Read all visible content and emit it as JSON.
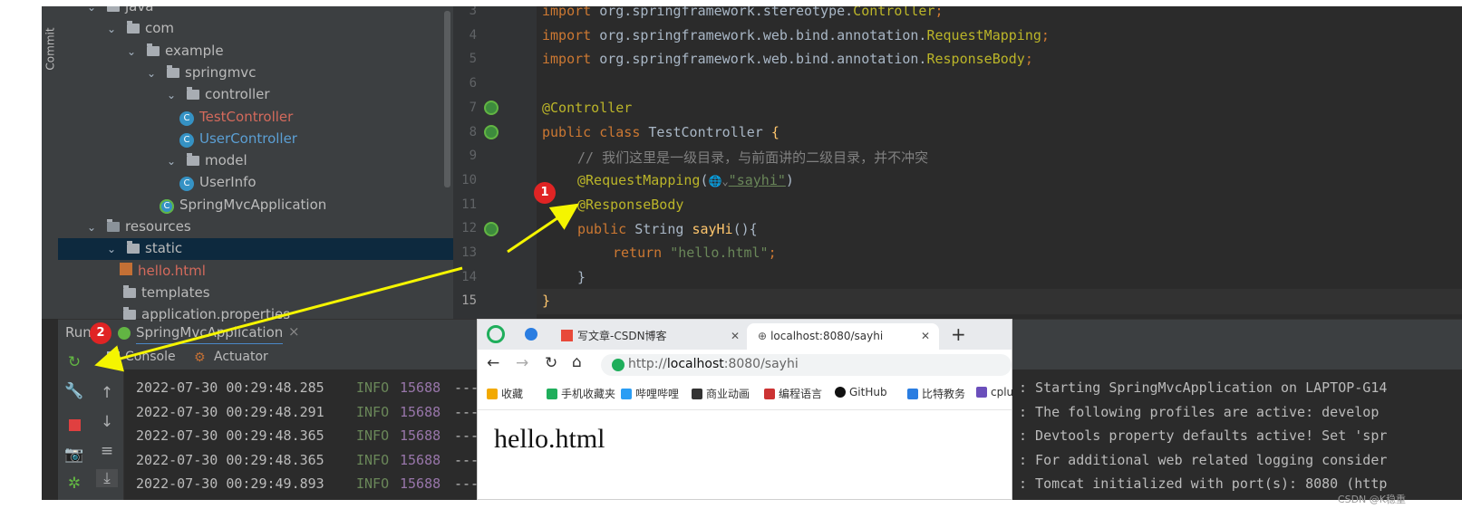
{
  "ide": {
    "commit_label": "Commit",
    "project_tree": [
      {
        "label": "java",
        "indent": 0,
        "type": "folder-partial"
      },
      {
        "label": "com",
        "indent": 1,
        "type": "package"
      },
      {
        "label": "example",
        "indent": 2,
        "type": "package"
      },
      {
        "label": "springmvc",
        "indent": 3,
        "type": "package"
      },
      {
        "label": "controller",
        "indent": 4,
        "type": "package"
      },
      {
        "label": "TestController",
        "indent": 5,
        "type": "class-modified"
      },
      {
        "label": "UserController",
        "indent": 5,
        "type": "class-new"
      },
      {
        "label": "model",
        "indent": 4,
        "type": "package"
      },
      {
        "label": "UserInfo",
        "indent": 5,
        "type": "class"
      },
      {
        "label": "SpringMvcApplication",
        "indent": 4,
        "type": "boot-class"
      },
      {
        "label": "resources",
        "indent": 0,
        "type": "resources"
      },
      {
        "label": "static",
        "indent": 1,
        "type": "folder-selected"
      },
      {
        "label": "hello.html",
        "indent": 2,
        "type": "html-modified"
      },
      {
        "label": "templates",
        "indent": 1,
        "type": "folder"
      },
      {
        "label": "application.properties",
        "indent": 1,
        "type": "partial"
      }
    ],
    "line_numbers": [
      "3",
      "4",
      "5",
      "6",
      "7",
      "8",
      "9",
      "10",
      "11",
      "12",
      "13",
      "14",
      "15"
    ],
    "code": {
      "l3_kw": "import",
      "l3_pkg": " org.springframework.stereotype.",
      "l3_cls": "Controller",
      "l3_end": ";",
      "l4_kw": "import",
      "l4_pkg": " org.springframework.web.bind.annotation.",
      "l4_cls": "RequestMapping",
      "l4_end": ";",
      "l5_kw": "import",
      "l5_pkg": " org.springframework.web.bind.annotation.",
      "l5_cls": "ResponseBody",
      "l5_end": ";",
      "l7_ann": "@Controller",
      "l8_kw": "public class",
      "l8_name": " TestController ",
      "l8_brace": "{",
      "l9_comment": "// 我们这里是一级目录，与前面讲的二级目录，并不冲突",
      "l10_ann": "@RequestMapping",
      "l10_open": "(",
      "l10_icon": "🌐⌄",
      "l10_str": "\"sayhi\"",
      "l10_close": ")",
      "l11_ann": "@ResponseBody",
      "l12_kw": "public",
      "l12_type": " String ",
      "l12_fn": "sayHi",
      "l12_rest": "(){",
      "l13_kw": "return",
      "l13_str": " \"hello.html\"",
      "l13_end": ";",
      "l14": "}",
      "l15": "}"
    },
    "run": {
      "label": "Run:",
      "config": "SpringMvcApplication",
      "tab_console": "Console",
      "tab_actuator": "Actuator"
    },
    "logs": [
      {
        "time": "2022-07-30 00:29:48.285",
        "level": "INFO",
        "pid": "15688",
        "sep": "---",
        "msg": ": Starting SpringMvcApplication on LAPTOP-G14"
      },
      {
        "time": "2022-07-30 00:29:48.291",
        "level": "INFO",
        "pid": "15688",
        "sep": "---",
        "msg": ": The following profiles are active: develop"
      },
      {
        "time": "2022-07-30 00:29:48.365",
        "level": "INFO",
        "pid": "15688",
        "sep": "---",
        "msg": ": Devtools property defaults active! Set 'spr"
      },
      {
        "time": "2022-07-30 00:29:48.365",
        "level": "INFO",
        "pid": "15688",
        "sep": "---",
        "msg": ": For additional web related logging consider"
      },
      {
        "time": "2022-07-30 00:29:49.893",
        "level": "INFO",
        "pid": "15688",
        "sep": "---",
        "msg": ": Tomcat initialized with port(s): 8080 (http"
      }
    ]
  },
  "browser": {
    "tab1_title": "写文章-CSDN博客",
    "tab2_title": "localhost:8080/sayhi",
    "new_tab": "+",
    "url_prefix": "http://",
    "url_host": "localhost",
    "url_rest": ":8080/sayhi",
    "bookmarks": [
      "收藏",
      "手机收藏夹",
      "哔哩哔哩",
      "商业动画",
      "编程语言",
      "GitHub",
      "比特教务",
      "cplu"
    ],
    "page_text": "hello.html"
  },
  "annotations": {
    "badge1": "1",
    "badge2": "2",
    "arrow_color": "#f5f500",
    "badge_color": "#e02424"
  },
  "watermark": "CSDN @K稳重"
}
